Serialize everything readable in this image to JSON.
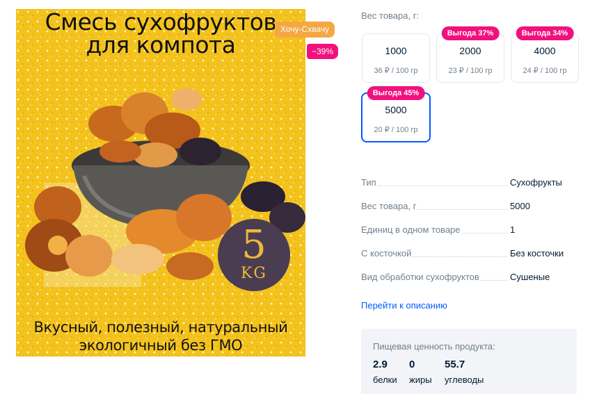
{
  "image": {
    "title_lines": [
      "Смесь сухофруктов",
      "для компота"
    ],
    "caption_lines": [
      "Вкусный, полезный, натуральный",
      "экологичный без ГМО"
    ],
    "badge_number": "5",
    "badge_unit": "KG",
    "sticker_promo": "Хочу-Схвачу",
    "sticker_discount": "−39%"
  },
  "weight_selector": {
    "label": "Вес товара, г:",
    "options": [
      {
        "value": "1000",
        "price": "36 ₽ / 100 гр",
        "badge": ""
      },
      {
        "value": "2000",
        "price": "23 ₽ / 100 гр",
        "badge": "Выгода 37%"
      },
      {
        "value": "4000",
        "price": "24 ₽ / 100 гр",
        "badge": "Выгода 34%"
      },
      {
        "value": "5000",
        "price": "20 ₽ / 100 гр",
        "badge": "Выгода 45%",
        "selected": true
      }
    ]
  },
  "characteristics": [
    {
      "name": "Тип",
      "value": "Сухофрукты"
    },
    {
      "name": "Вес товара, г",
      "value": "5000"
    },
    {
      "name": "Единиц в одном товаре",
      "value": "1"
    },
    {
      "name": "С косточкой",
      "value": "Без косточки"
    },
    {
      "name": "Вид обработки сухофруктов",
      "value": "Сушеные"
    }
  ],
  "description_link": "Перейти к описанию",
  "nutrition": {
    "title": "Пищевая ценность продукта:",
    "items": [
      {
        "value": "2.9",
        "label": "белки"
      },
      {
        "value": "0",
        "label": "жиры"
      },
      {
        "value": "55.7",
        "label": "углеводы"
      }
    ]
  },
  "colors": {
    "accent": "#005bff",
    "badge_pink": "#f1117e",
    "sticker_orange": "#f4a742",
    "image_yellow": "#f3c21c"
  }
}
